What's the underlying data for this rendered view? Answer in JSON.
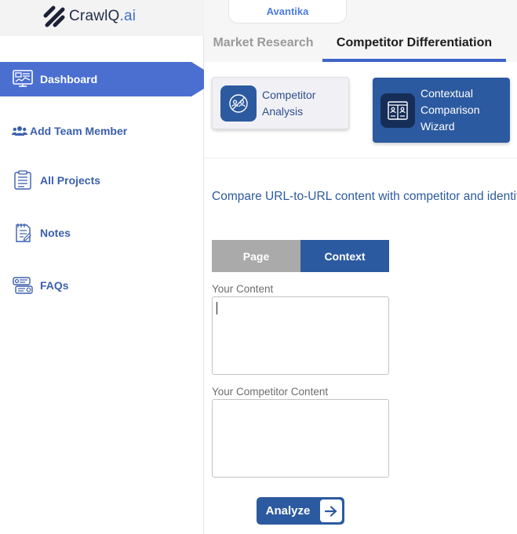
{
  "brand": {
    "name": "CrawlQ",
    "suffix": ".ai"
  },
  "sidebar": {
    "items": [
      {
        "label": "Dashboard",
        "icon": "dashboard-icon",
        "active": true
      },
      {
        "label": "Add Team Member",
        "icon": "users-icon"
      },
      {
        "label": "All Projects",
        "icon": "projects-icon"
      },
      {
        "label": "Notes",
        "icon": "notes-icon"
      },
      {
        "label": "FAQs",
        "icon": "faqs-icon"
      }
    ]
  },
  "header": {
    "user_name": "Avantika"
  },
  "top_tabs": [
    {
      "label": "Market Research",
      "active": false
    },
    {
      "label": "Competitor Differentiation",
      "active": true
    }
  ],
  "tools": [
    {
      "label_line1": "Competitor",
      "label_line2": "Analysis",
      "icon": "competitor-analysis-icon"
    },
    {
      "label_line1": "Contextual",
      "label_line2": "Comparison",
      "label_line3": "Wizard",
      "icon": "comparison-wizard-icon",
      "active": true
    }
  ],
  "main": {
    "headline": "Compare URL-to-URL content with competitor and identify",
    "mode_tabs": [
      {
        "label": "Page",
        "active": false
      },
      {
        "label": "Context",
        "active": true
      }
    ],
    "your_content_label": "Your Content",
    "your_content_value": "",
    "competitor_content_label": "Your Competitor Content",
    "competitor_content_value": "",
    "analyze_label": "Analyze"
  },
  "colors": {
    "primary": "#2c5aa0",
    "sidebar_active": "#4a6fd0",
    "tab_underline": "#3f63c8",
    "link_blue": "#3b5fae"
  }
}
